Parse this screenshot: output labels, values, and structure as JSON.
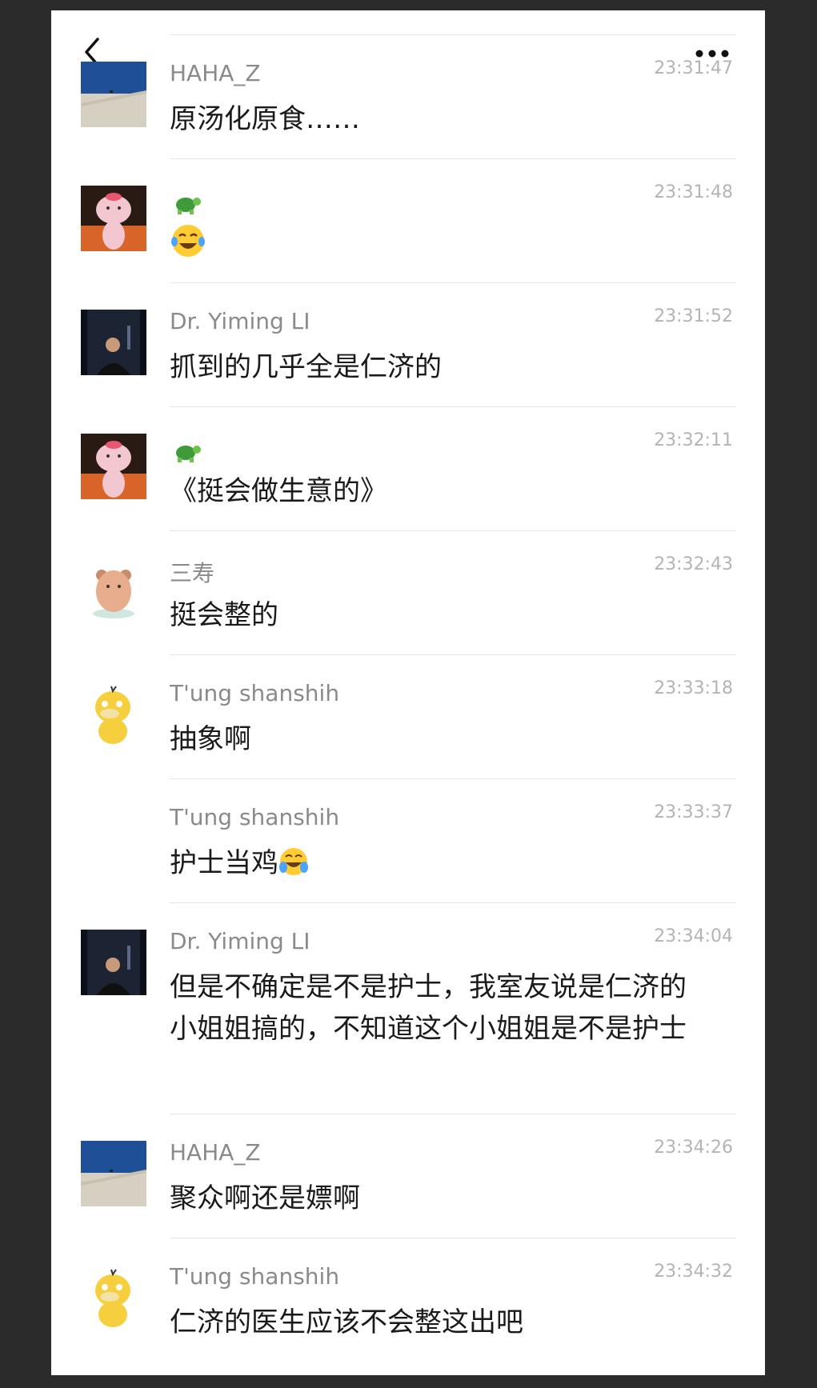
{
  "header": {
    "back_icon": "chevron-left-icon",
    "more_icon": "more-dots-icon"
  },
  "messages": [
    {
      "sender": "HAHA_Z",
      "time": "23:31:47",
      "text": "原汤化原食……",
      "avatar": "sky-wall-avatar"
    },
    {
      "sender": "",
      "sender_icon": "turtle-emoji",
      "time": "23:31:48",
      "text": "",
      "text_icon": "laughing-tears-emoji",
      "avatar": "pink-pig-avatar"
    },
    {
      "sender": "Dr. Yiming LI",
      "time": "23:31:52",
      "text": "抓到的几乎全是仁济的",
      "avatar": "city-night-man-avatar"
    },
    {
      "sender": "",
      "sender_icon": "turtle-emoji",
      "time": "23:32:11",
      "text": "《挺会做生意的》",
      "avatar": "pink-pig-avatar"
    },
    {
      "sender": "三寿",
      "time": "23:32:43",
      "text": "挺会整的",
      "avatar": "bear-avatar"
    },
    {
      "sender": "T'ung shanshih",
      "time": "23:33:18",
      "text": "抽象啊",
      "avatar": "yellow-duck-avatar"
    },
    {
      "sender": "T'ung shanshih",
      "time": "23:33:37",
      "text": "护士当鸡",
      "text_icon": "crying-laughing-emoji",
      "avatar": ""
    },
    {
      "sender": "Dr. Yiming LI",
      "time": "23:34:04",
      "text": "但是不确定是不是护士，我室友说是仁济的小姐姐搞的，不知道这个小姐姐是不是护士",
      "avatar": "city-night-man-avatar"
    },
    {
      "sender": "HAHA_Z",
      "time": "23:34:26",
      "text": "聚众啊还是嫖啊",
      "avatar": "sky-wall-avatar"
    },
    {
      "sender": "T'ung shanshih",
      "time": "23:34:32",
      "text": "仁济的医生应该不会整这出吧",
      "avatar": "yellow-duck-avatar"
    }
  ]
}
